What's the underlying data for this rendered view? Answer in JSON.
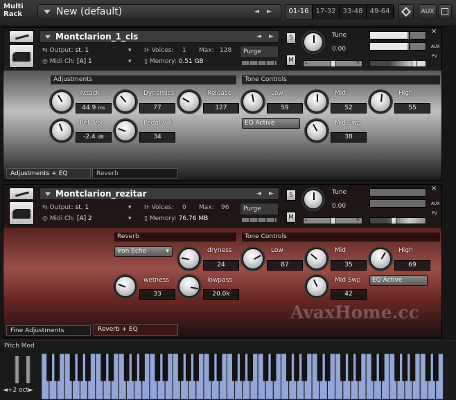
{
  "header": {
    "title_line1": "Multi",
    "title_line2": "Rack",
    "rack_name": "New (default)",
    "prev": "◄",
    "next": "►",
    "pages": [
      "01-16",
      "17-32",
      "33-48",
      "49-64"
    ],
    "aux": "AUX"
  },
  "instruments": [
    {
      "name": "Montclarion_1_cls",
      "output_label": "Output:",
      "output": "st. 1",
      "voices_label": "Voices:",
      "voices": "1",
      "max_label": "Max:",
      "max": "128",
      "midi_label": "Midi Ch:",
      "midi": "[A] 1",
      "memory_label": "Memory:",
      "memory": "0.51 GB",
      "purge": "Purge",
      "solo": "S",
      "mute": "M",
      "tune_label": "Tune",
      "tune": "0.00",
      "pan_l": "L",
      "pan_r": "R",
      "aux": "AUX",
      "pv": "PV",
      "level_meter": [
        0.68,
        0.68
      ],
      "sections": {
        "adjustments": "Adjustments",
        "tone": "Tone Controls"
      },
      "knobs": [
        {
          "label": "Attack",
          "value": "44.9",
          "unit": "ms"
        },
        {
          "label": "Dynamics",
          "value": "77"
        },
        {
          "label": "Release",
          "value": "127"
        },
        {
          "label": "Rel. Vol",
          "value": "-2.4",
          "unit": "dB"
        },
        {
          "label": "Pedal Vol",
          "value": "34"
        },
        {
          "label": "Low",
          "value": "59"
        },
        {
          "label": "Mid",
          "value": "52"
        },
        {
          "label": "High",
          "value": "55"
        },
        {
          "label": "Mid Swp",
          "value": "38"
        }
      ],
      "eq_button": "EQ Active",
      "tabs": [
        "Adjustments + EQ",
        "Reverb"
      ]
    },
    {
      "name": "Montclarion_rezitar",
      "output_label": "Output:",
      "output": "st. 1",
      "voices_label": "Voices:",
      "voices": "0",
      "max_label": "Max:",
      "max": "96",
      "midi_label": "Midi Ch:",
      "midi": "[A] 2",
      "memory_label": "Memory:",
      "memory": "76.76 MB",
      "purge": "Purge",
      "solo": "S",
      "mute": "M",
      "tune_label": "Tune",
      "tune": "0.00",
      "pan_l": "L",
      "pan_r": "R",
      "aux": "AUX",
      "pv": "PV",
      "level_meter": [
        0,
        0
      ],
      "sections": {
        "reverb": "Reverb",
        "tone": "Tone Controls"
      },
      "reverb_select": "Iron Echo",
      "knobs": [
        {
          "label": "dryness",
          "value": "24"
        },
        {
          "label": "wetness",
          "value": "33"
        },
        {
          "label": "lowpass",
          "value": "20.0k"
        },
        {
          "label": "Low",
          "value": "87"
        },
        {
          "label": "Mid",
          "value": "35"
        },
        {
          "label": "High",
          "value": "69"
        },
        {
          "label": "Mid Swp",
          "value": "42"
        }
      ],
      "eq_button": "EQ Active",
      "tabs": [
        "Fine Adjustments",
        "Reverb + EQ"
      ]
    }
  ],
  "watermark": "AvaxHome.cc",
  "keyboard": {
    "pitch_mod": "Pitch Mod",
    "octave": "+2 oct",
    "octave_prev": "◄",
    "octave_next": "►"
  },
  "colors": {
    "key_blue": "#93a6d6",
    "panel2_accent": "#9a4e48"
  }
}
